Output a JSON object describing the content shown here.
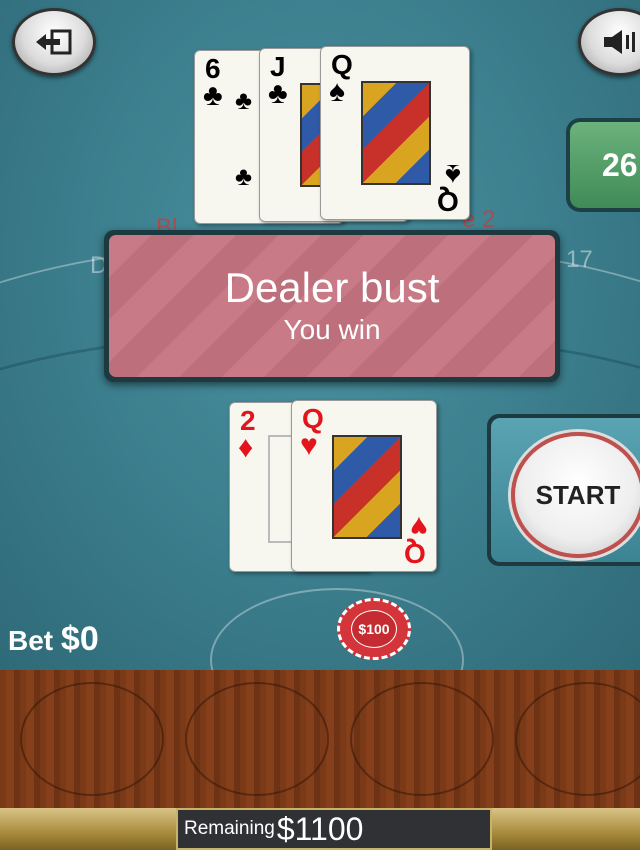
{
  "top_bar": {
    "exit_icon": "exit-arrow-icon",
    "sound_icon": "speaker-icon"
  },
  "counter": {
    "value": "26"
  },
  "felt": {
    "left_text": "D",
    "right_text": "17",
    "red_text_left": "Bl",
    "red_text_right": "e 2"
  },
  "dealer_cards": [
    {
      "rank": "6",
      "suit": "♣",
      "color": "#000000"
    },
    {
      "rank": "J",
      "suit": "♣",
      "color": "#000000"
    },
    {
      "rank": "Q",
      "suit": "♠",
      "color": "#000000"
    }
  ],
  "player_cards": [
    {
      "rank": "2",
      "suit": "♦",
      "color": "#e4141c"
    },
    {
      "rank": "Q",
      "suit": "♥",
      "color": "#e4141c"
    }
  ],
  "result": {
    "title": "Dealer bust",
    "subtitle": "You win"
  },
  "start_button": {
    "label": "START"
  },
  "bet": {
    "label": "Bet",
    "amount": "$0"
  },
  "chip": {
    "label": "$100"
  },
  "remaining": {
    "label": "Remaining",
    "amount": "$1100"
  }
}
